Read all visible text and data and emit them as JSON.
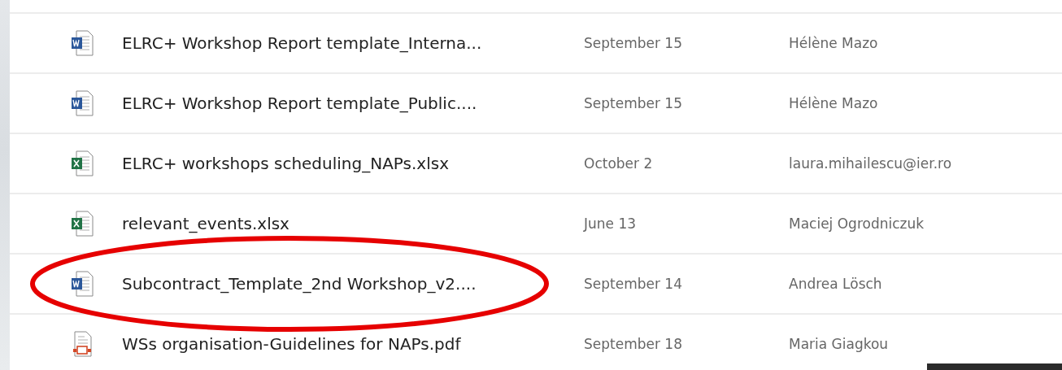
{
  "files": [
    {
      "kind": "word",
      "name": "ELRC+ Workshop Report template_Interna...",
      "modified": "September 15",
      "author": "Hélène Mazo",
      "circled": false
    },
    {
      "kind": "word",
      "name": "ELRC+ Workshop Report template_Public....",
      "modified": "September 15",
      "author": "Hélène Mazo",
      "circled": false
    },
    {
      "kind": "excel",
      "name": "ELRC+ workshops scheduling_NAPs.xlsx",
      "modified": "October 2",
      "author": "laura.mihailescu@ier.ro",
      "circled": false
    },
    {
      "kind": "excel",
      "name": "relevant_events.xlsx",
      "modified": "June 13",
      "author": "Maciej Ogrodniczuk",
      "circled": false
    },
    {
      "kind": "word",
      "name": "Subcontract_Template_2nd Workshop_v2....",
      "modified": "September 14",
      "author": "Andrea Lösch",
      "circled": true
    },
    {
      "kind": "pdf",
      "name": "WSs organisation-Guidelines for NAPs.pdf",
      "modified": "September 18",
      "author": "Maria Giagkou",
      "circled": false
    }
  ]
}
